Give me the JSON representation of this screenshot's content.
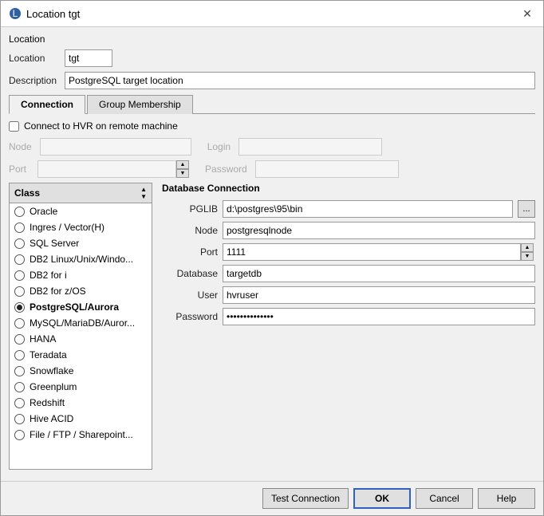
{
  "dialog": {
    "title": "Location tgt",
    "icon": "location-icon"
  },
  "location_section": {
    "label": "Location",
    "location_label": "Location",
    "location_value": "tgt",
    "description_label": "Description",
    "description_value": "PostgreSQL target location"
  },
  "tabs": {
    "connection_label": "Connection",
    "group_membership_label": "Group Membership",
    "active": "connection"
  },
  "connection": {
    "checkbox_label": "Connect to HVR on remote machine",
    "node_label": "Node",
    "port_label": "Port",
    "login_label": "Login",
    "password_label": "Password"
  },
  "class_panel": {
    "header": "Class",
    "items": [
      {
        "label": "Oracle",
        "selected": false
      },
      {
        "label": "Ingres / Vector(H)",
        "selected": false
      },
      {
        "label": "SQL Server",
        "selected": false
      },
      {
        "label": "DB2 Linux/Unix/Windo...",
        "selected": false
      },
      {
        "label": "DB2 for i",
        "selected": false
      },
      {
        "label": "DB2 for z/OS",
        "selected": false
      },
      {
        "label": "PostgreSQL/Aurora",
        "selected": true
      },
      {
        "label": "MySQL/MariaDB/Auror...",
        "selected": false
      },
      {
        "label": "HANA",
        "selected": false
      },
      {
        "label": "Teradata",
        "selected": false
      },
      {
        "label": "Snowflake",
        "selected": false
      },
      {
        "label": "Greenplum",
        "selected": false
      },
      {
        "label": "Redshift",
        "selected": false
      },
      {
        "label": "Hive ACID",
        "selected": false
      },
      {
        "label": "File / FTP / Sharepoint...",
        "selected": false
      }
    ]
  },
  "database_connection": {
    "title": "Database Connection",
    "pglib_label": "PGLIB",
    "pglib_value": "d:\\postgres\\95\\bin",
    "browse_label": "...",
    "node_label": "Node",
    "node_value": "postgresqlnode",
    "port_label": "Port",
    "port_value": "1111",
    "database_label": "Database",
    "database_value": "targetdb",
    "user_label": "User",
    "user_value": "hvruser",
    "password_label": "Password",
    "password_value": "••••••••••••••"
  },
  "buttons": {
    "test_connection": "Test Connection",
    "ok": "OK",
    "cancel": "Cancel",
    "help": "Help"
  }
}
